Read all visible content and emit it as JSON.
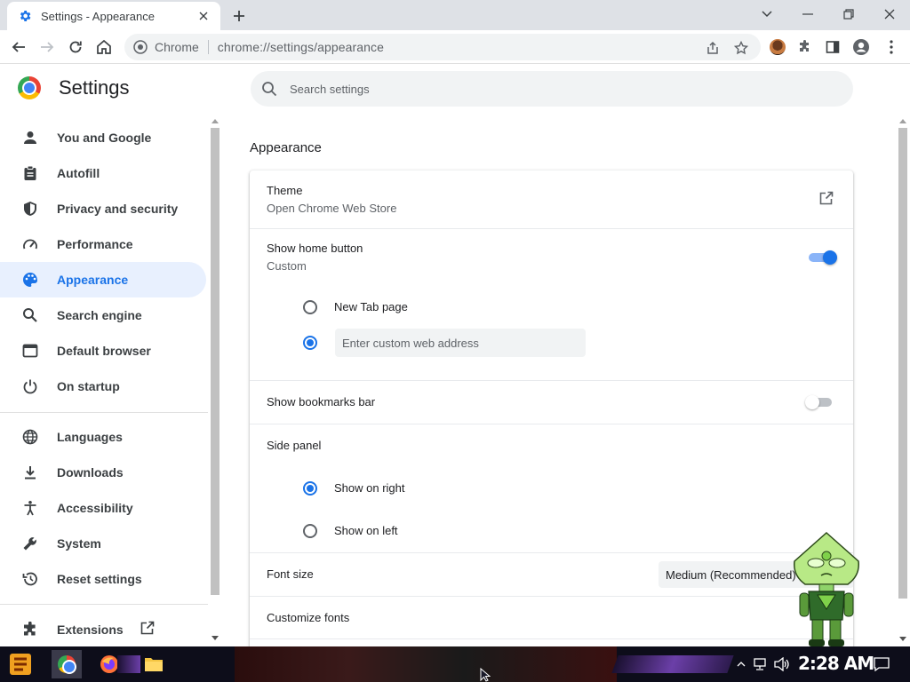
{
  "tab": {
    "title": "Settings - Appearance",
    "favicon": "gear-icon"
  },
  "toolbar": {
    "site_chip": "Chrome",
    "url": "chrome://settings/appearance"
  },
  "settings": {
    "title": "Settings",
    "search_placeholder": "Search settings"
  },
  "sidebar": {
    "items": [
      {
        "label": "You and Google",
        "icon": "person-icon"
      },
      {
        "label": "Autofill",
        "icon": "clipboard-icon"
      },
      {
        "label": "Privacy and security",
        "icon": "shield-icon"
      },
      {
        "label": "Performance",
        "icon": "speedometer-icon"
      },
      {
        "label": "Appearance",
        "icon": "palette-icon",
        "active": true
      },
      {
        "label": "Search engine",
        "icon": "search-icon"
      },
      {
        "label": "Default browser",
        "icon": "browser-window-icon"
      },
      {
        "label": "On startup",
        "icon": "power-icon"
      },
      {
        "label": "Languages",
        "icon": "globe-icon"
      },
      {
        "label": "Downloads",
        "icon": "download-icon"
      },
      {
        "label": "Accessibility",
        "icon": "accessibility-icon"
      },
      {
        "label": "System",
        "icon": "wrench-icon"
      },
      {
        "label": "Reset settings",
        "icon": "history-icon"
      },
      {
        "label": "Extensions",
        "icon": "puzzle-icon"
      }
    ]
  },
  "appearance": {
    "section_title": "Appearance",
    "theme": {
      "label": "Theme",
      "sub": "Open Chrome Web Store"
    },
    "home_button": {
      "label": "Show home button",
      "sub": "Custom",
      "enabled": true,
      "options": [
        "New Tab page"
      ],
      "custom_placeholder": "Enter custom web address",
      "selected": "custom"
    },
    "bookmarks_bar": {
      "label": "Show bookmarks bar",
      "enabled": false
    },
    "side_panel": {
      "label": "Side panel",
      "options": [
        "Show on right",
        "Show on left"
      ],
      "selected": "Show on right"
    },
    "font_size": {
      "label": "Font size",
      "value": "Medium (Recommended)"
    },
    "customize_fonts": {
      "label": "Customize fonts"
    }
  },
  "taskbar": {
    "clock": "2:28 AM"
  },
  "colors": {
    "accent": "#1a73e8",
    "active_bg": "#e8f0fe"
  }
}
